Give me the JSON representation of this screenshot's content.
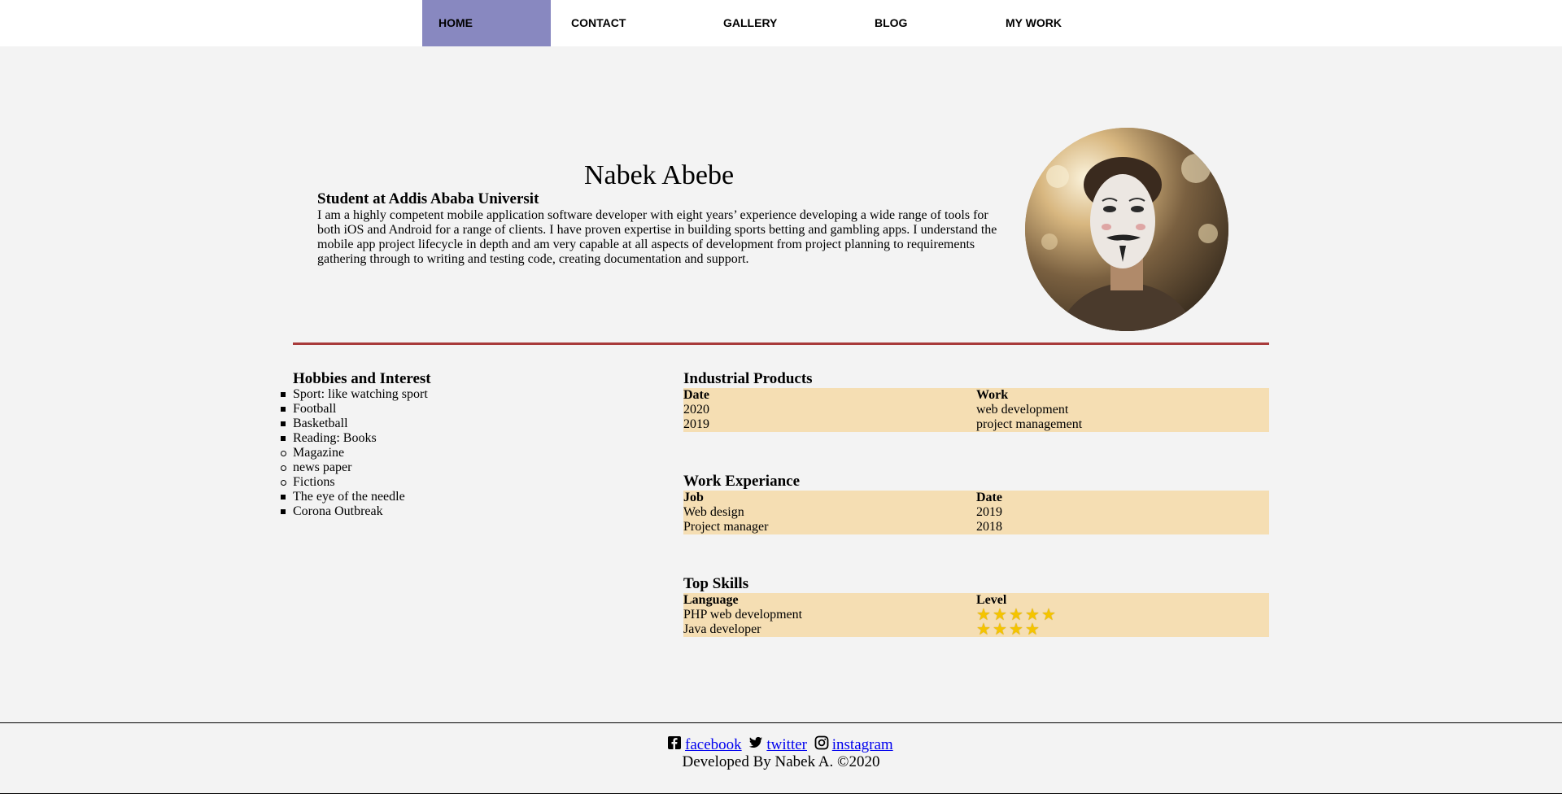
{
  "nav": {
    "items": [
      {
        "label": "HOME",
        "active": true
      },
      {
        "label": "CONTACT",
        "active": false
      },
      {
        "label": "GALLERY",
        "active": false
      },
      {
        "label": "BLOG",
        "active": false
      },
      {
        "label": "MY WORK",
        "active": false
      }
    ],
    "active_color": "#8888c0"
  },
  "profile": {
    "name": "Nabek Abebe",
    "subtitle": "Student at Addis Ababa Universit",
    "bio": "I am a highly competent mobile application software developer with eight years’ experience developing a wide range of tools for both iOS and Android for a range of clients. I have proven expertise in building sports betting and gambling apps. I understand the mobile app project lifecycle in depth and am very capable at all aspects of development from project planning to requirements gathering through to writing and testing code, creating documentation and support."
  },
  "hobbies": {
    "title": "Hobbies and Interest",
    "items": [
      {
        "text": "Sport: like watching sport",
        "style": "square"
      },
      {
        "text": "Football",
        "style": "square"
      },
      {
        "text": "Basketball",
        "style": "square"
      },
      {
        "text": "Reading: Books",
        "style": "square"
      },
      {
        "text": "Magazine",
        "style": "circle"
      },
      {
        "text": "news paper",
        "style": "circle"
      },
      {
        "text": "Fictions",
        "style": "circle"
      },
      {
        "text": "The eye of the needle",
        "style": "square"
      },
      {
        "text": "Corona Outbreak",
        "style": "square"
      }
    ]
  },
  "industrial": {
    "title": "Industrial Products",
    "headers": [
      "Date",
      "Work"
    ],
    "rows": [
      [
        "2020",
        "web development"
      ],
      [
        "2019",
        "project management"
      ]
    ]
  },
  "experience": {
    "title": "Work Experiance",
    "headers": [
      "Job",
      "Date"
    ],
    "rows": [
      [
        "Web design",
        "2019"
      ],
      [
        "Project manager",
        "2018"
      ]
    ]
  },
  "skills": {
    "title": "Top Skills",
    "headers": [
      "Language",
      "Level"
    ],
    "rows": [
      {
        "language": "PHP web development",
        "stars": 5
      },
      {
        "language": "Java developer",
        "stars": 4
      }
    ]
  },
  "footer": {
    "links": [
      {
        "label": "facebook",
        "icon": "facebook-icon"
      },
      {
        "label": "twitter",
        "icon": "twitter-icon"
      },
      {
        "label": "instagram",
        "icon": "instagram-icon"
      }
    ],
    "copyright": "Developed By Nabek A. ©2020"
  },
  "colors": {
    "table_bg": "#f5deb3",
    "divider": "#a83a3a",
    "star": "#f5c400"
  }
}
